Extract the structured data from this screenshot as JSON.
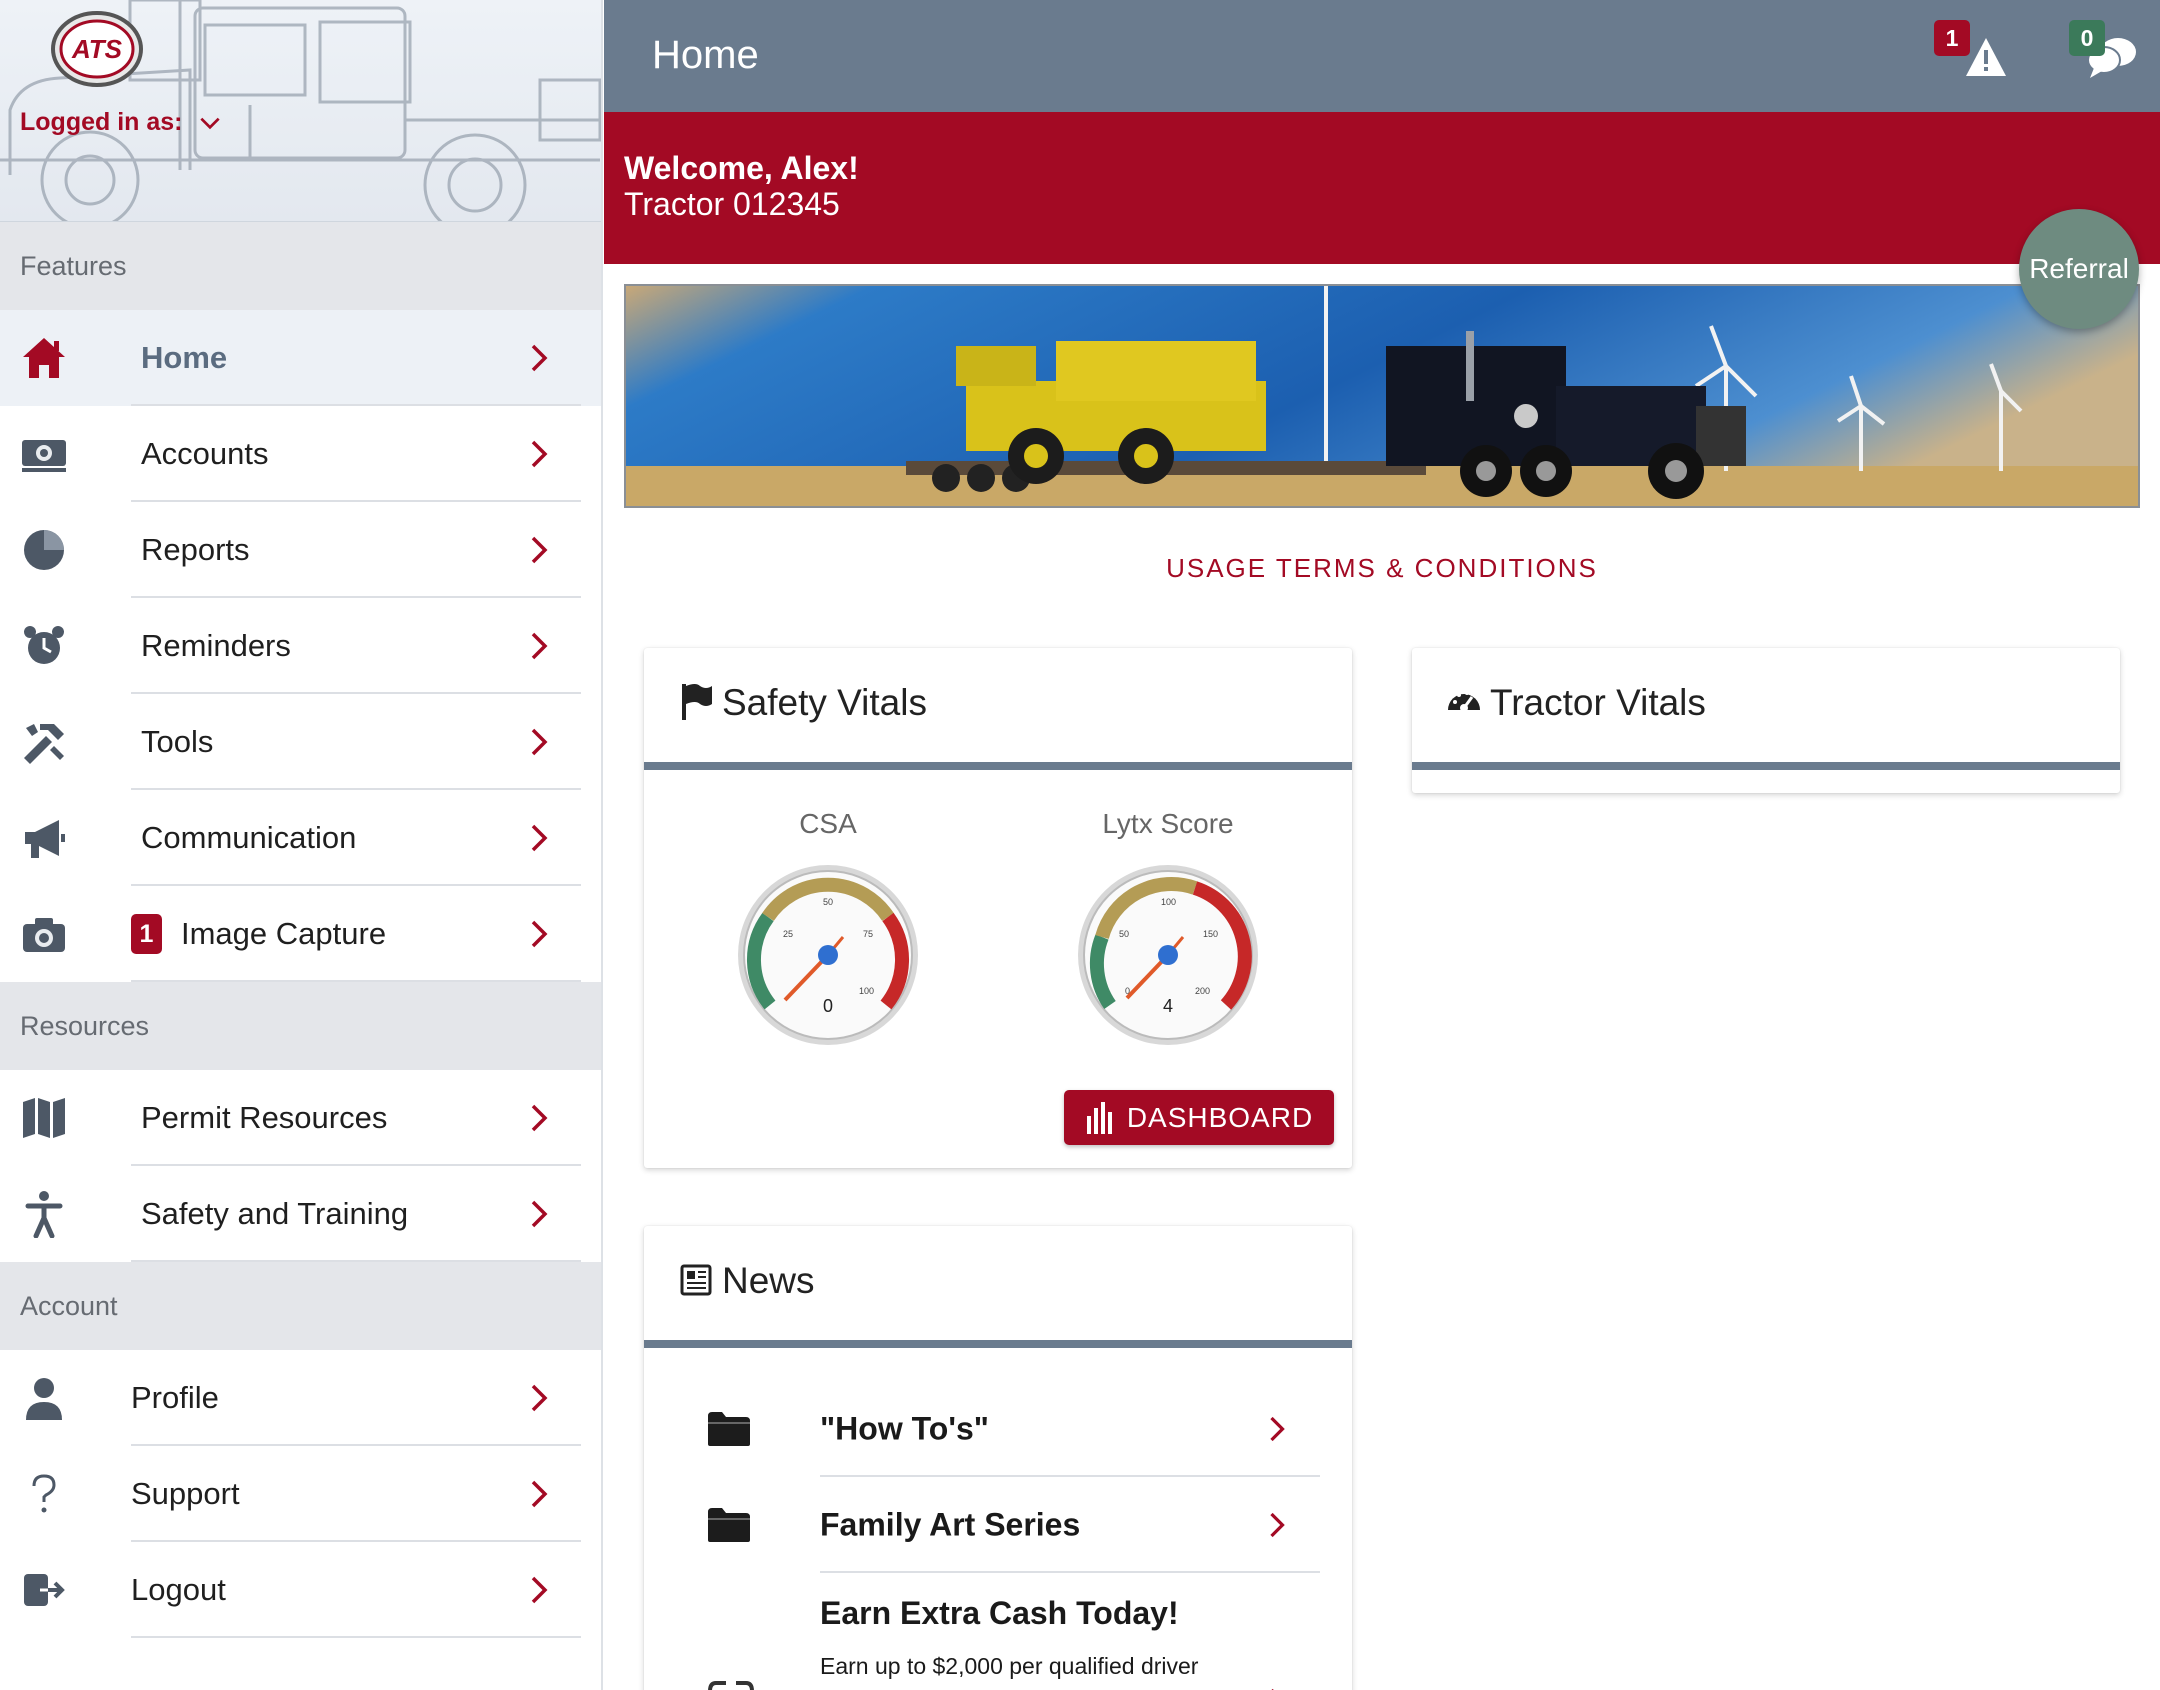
{
  "app": {
    "logo_text": "ATS",
    "logged_in_label": "Logged in as:"
  },
  "sidebar": {
    "sections": {
      "features": "Features",
      "resources": "Resources",
      "account": "Account"
    },
    "features": [
      {
        "label": "Home",
        "icon": "home-icon",
        "active": true
      },
      {
        "label": "Accounts",
        "icon": "money-icon"
      },
      {
        "label": "Reports",
        "icon": "pie-chart-icon"
      },
      {
        "label": "Reminders",
        "icon": "alarm-clock-icon"
      },
      {
        "label": "Tools",
        "icon": "tools-icon"
      },
      {
        "label": "Communication",
        "icon": "megaphone-icon"
      },
      {
        "label": "Image Capture",
        "icon": "camera-icon",
        "badge": "1"
      }
    ],
    "resources": [
      {
        "label": "Permit Resources",
        "icon": "map-icon"
      },
      {
        "label": "Safety and Training",
        "icon": "person-icon"
      }
    ],
    "account": [
      {
        "label": "Profile",
        "icon": "user-icon"
      },
      {
        "label": "Support",
        "icon": "question-icon"
      },
      {
        "label": "Logout",
        "icon": "logout-icon"
      }
    ]
  },
  "topbar": {
    "title": "Home",
    "alerts_count": "1",
    "messages_count": "0"
  },
  "welcome": {
    "greeting": "Welcome, Alex!",
    "tractor": "Tractor 012345"
  },
  "referral_label": "Referral",
  "terms_link": "USAGE TERMS & CONDITIONS",
  "safety_vitals": {
    "title": "Safety Vitals",
    "gauges": [
      {
        "label": "CSA",
        "value": "0",
        "ticks": [
          "25",
          "50",
          "75",
          "100"
        ]
      },
      {
        "label": "Lytx Score",
        "value": "4",
        "ticks": [
          "50",
          "100",
          "150",
          "200",
          "0"
        ]
      }
    ],
    "dashboard_button": "DASHBOARD"
  },
  "tractor_vitals": {
    "title": "Tractor Vitals"
  },
  "news": {
    "title": "News",
    "items": [
      {
        "title": "\"How To's\""
      },
      {
        "title": "Family Art Series"
      }
    ],
    "promo": {
      "title": "Earn Extra Cash Today!",
      "subtitle": "Earn up to $2,000 per qualified driver"
    }
  },
  "colors": {
    "brand_red": "#a30a24",
    "slate": "#6a7b8e",
    "referral_green": "#6e8b80",
    "messages_green": "#3b7a5a"
  }
}
